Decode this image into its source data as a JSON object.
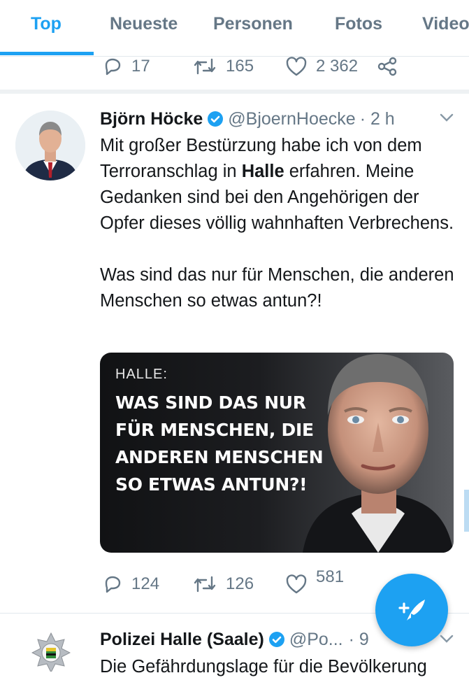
{
  "tabs": [
    {
      "label": "Top",
      "active": true
    },
    {
      "label": "Neueste"
    },
    {
      "label": "Personen"
    },
    {
      "label": "Fotos"
    },
    {
      "label": "Videos"
    }
  ],
  "prev_tweet_actions": {
    "replies": "17",
    "retweets": "165",
    "likes": "2 362"
  },
  "tweet": {
    "name": "Björn Höcke",
    "handle": "@BjoernHoecke",
    "time": "· 2 h",
    "text_1_pre": "Mit großer Bestürzung habe ich von dem Terroranschlag in ",
    "text_1_bold": "Halle",
    "text_1_post": " erfahren. Meine Gedanken sind bei den Angehörigen der Opfer dieses völlig wahnhaften Verbrechens.",
    "text_2": "Was sind das nur für Menschen, die anderen Menschen so etwas antun?!",
    "media": {
      "kicker": "HALLE:",
      "headline_lines": [
        "WAS SIND DAS NUR",
        "FÜR MENSCHEN, DIE",
        "ANDEREN MENSCHEN",
        "SO ETWAS ANTUN?!"
      ]
    },
    "actions": {
      "replies": "124",
      "retweets": "126",
      "likes": "581"
    }
  },
  "next_tweet": {
    "name": "Polizei Halle (Saale)",
    "handle": "@Po...",
    "time": "· 9",
    "text": "Die Gefährdungslage für die Bevölkerung"
  },
  "colors": {
    "accent": "#1da1f2",
    "muted": "#657786",
    "text": "#14171a"
  },
  "icons": [
    "reply-icon",
    "retweet-icon",
    "like-icon",
    "share-icon",
    "verified-icon",
    "chevron-down-icon",
    "compose-tweet-icon"
  ]
}
